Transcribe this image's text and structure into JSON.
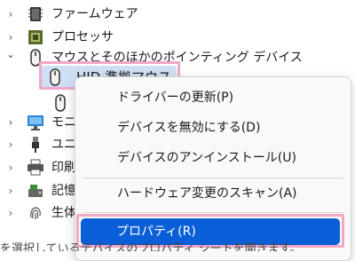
{
  "tree": {
    "items": [
      {
        "label": "ファームウェア",
        "icon": "firmware-chip-icon",
        "chevron": "›"
      },
      {
        "label": "プロセッサ",
        "icon": "processor-icon",
        "chevron": "›"
      },
      {
        "label": "マウスとそのほかのポインティング デバイス",
        "icon": "mouse-icon",
        "chevron": "⌄"
      },
      {
        "label": "HID 準拠マウス",
        "icon": "mouse-icon"
      },
      {
        "label": "",
        "icon": "mouse-icon"
      },
      {
        "label": "モニ",
        "icon": "monitor-icon",
        "chevron": "›"
      },
      {
        "label": "ユニ",
        "icon": "usb-connector-icon",
        "chevron": "›"
      },
      {
        "label": "印刷",
        "icon": "printer-icon",
        "chevron": "›"
      },
      {
        "label": "記憶",
        "icon": "storage-icon",
        "chevron": "›"
      },
      {
        "label": "生体",
        "icon": "fingerprint-icon",
        "chevron": "›"
      }
    ]
  },
  "context_menu": {
    "items": [
      {
        "label": "ドライバーの更新(P)"
      },
      {
        "label": "デバイスを無効にする(D)"
      },
      {
        "label": "デバイスのアンインストール(U)"
      },
      {
        "label": "ハードウェア変更のスキャン(A)"
      },
      {
        "label": "プロパティ(R)"
      }
    ]
  },
  "status_bar": {
    "text": "を選択しているデバイスのプロパティ シートを開きます。"
  },
  "colors": {
    "accent": "#0a5fd8",
    "selection": "#cfe0f5",
    "highlight_border": "#f0a8c8"
  }
}
